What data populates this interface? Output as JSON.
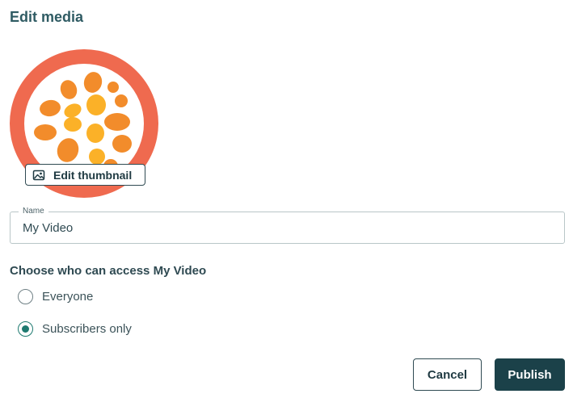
{
  "dialog": {
    "title": "Edit media"
  },
  "thumbnail": {
    "edit_label": "Edit thumbnail",
    "colors": {
      "ring": "#ef6a4f",
      "inner": "#ffffff",
      "orange": "#f28c2b",
      "yellow": "#fbb128"
    }
  },
  "name_field": {
    "label": "Name",
    "value": "My Video"
  },
  "access": {
    "heading": "Choose who can access My Video",
    "options": [
      {
        "label": "Everyone",
        "selected": false
      },
      {
        "label": "Subscribers only",
        "selected": true
      }
    ]
  },
  "actions": {
    "cancel_label": "Cancel",
    "publish_label": "Publish"
  },
  "colors": {
    "accent": "#1e7a70",
    "primary_button": "#1b4149",
    "text": "#2f4a52"
  }
}
